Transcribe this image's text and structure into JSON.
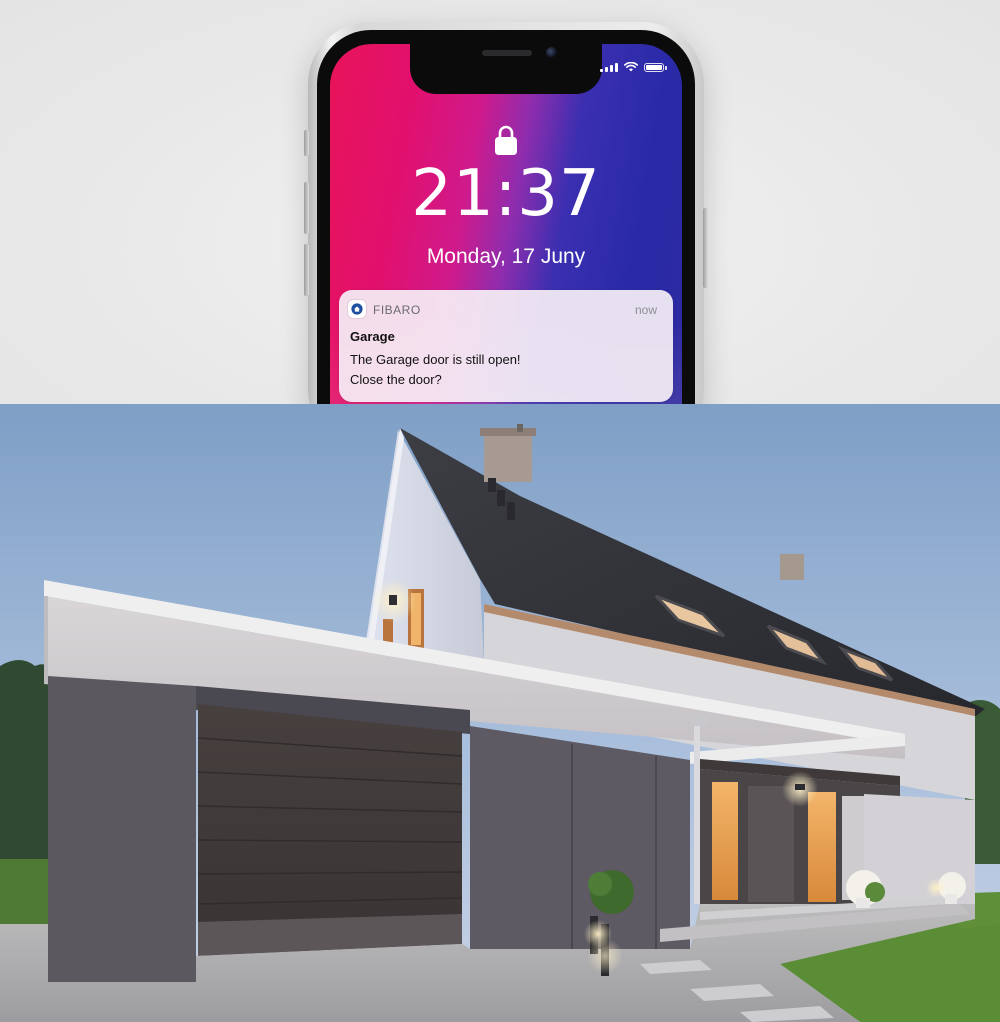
{
  "phone": {
    "lock_screen": {
      "time": "21:37",
      "date": "Monday, 17 Juny"
    },
    "status_icons": [
      "signal-icon",
      "wifi-icon",
      "battery-icon"
    ],
    "notification": {
      "app_name": "FIBARO",
      "time": "now",
      "title": "Garage",
      "body_line1": "The Garage door is still open!",
      "body_line2": "Close the door?",
      "app_icon": "home-icon"
    }
  },
  "photo": {
    "subject": "house-with-garage-photo"
  },
  "colors": {
    "wallpaper_pink": "#e1106e",
    "wallpaper_blue": "#2a2aa8",
    "notification_bg": "#f6f0f6"
  }
}
